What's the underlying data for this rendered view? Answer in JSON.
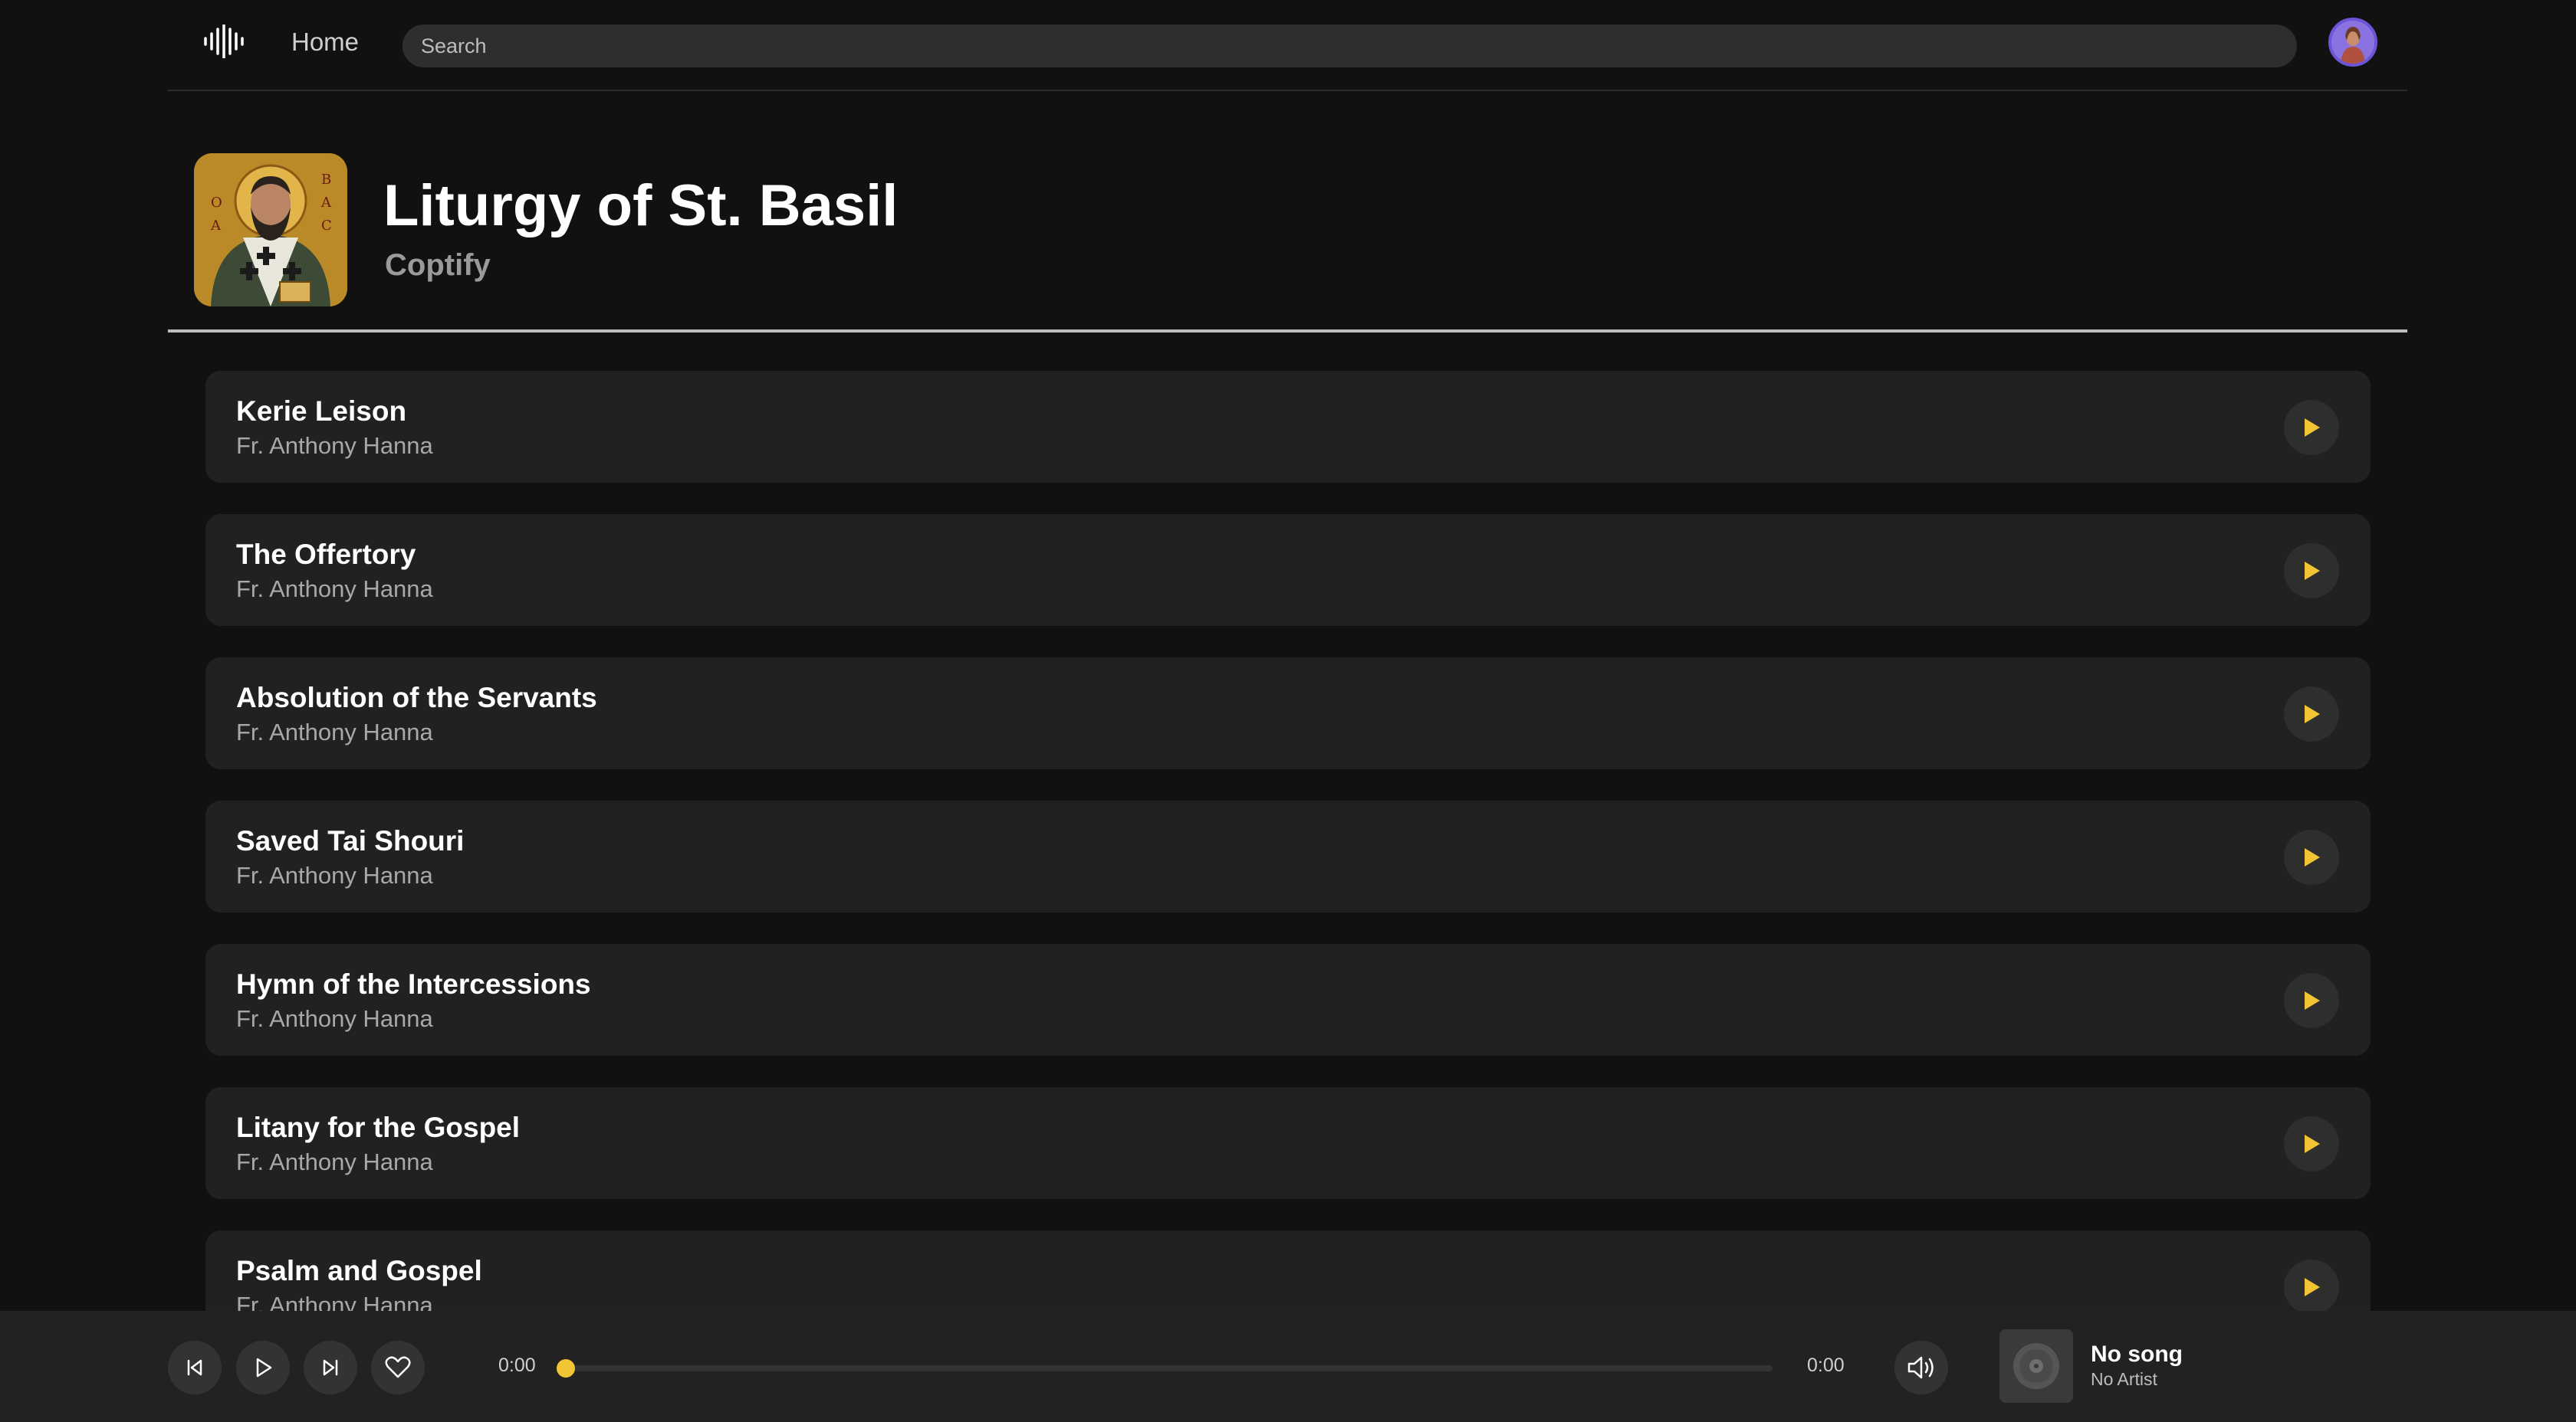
{
  "nav": {
    "home_label": "Home",
    "search_placeholder": "Search",
    "logo_icon": "waveform-icon",
    "avatar_icon": "user-avatar"
  },
  "album": {
    "title": "Liturgy of St. Basil",
    "subtitle": "Coptify",
    "cover_icon": "icon-portrait"
  },
  "tracks": [
    {
      "title": "Kerie Leison",
      "artist": "Fr. Anthony Hanna"
    },
    {
      "title": "The Offertory",
      "artist": "Fr. Anthony Hanna"
    },
    {
      "title": "Absolution of the Servants",
      "artist": "Fr. Anthony Hanna"
    },
    {
      "title": "Saved Tai Shouri",
      "artist": "Fr. Anthony Hanna"
    },
    {
      "title": "Hymn of the Intercessions",
      "artist": "Fr. Anthony Hanna"
    },
    {
      "title": "Litany for the Gospel",
      "artist": "Fr. Anthony Hanna"
    },
    {
      "title": "Psalm and Gospel",
      "artist": "Fr. Anthony Hanna"
    }
  ],
  "player": {
    "current_time": "0:00",
    "duration": "0:00",
    "progress": 0,
    "now_playing_title": "No song",
    "now_playing_artist": "No Artist",
    "icons": [
      "skip-back-icon",
      "play-icon",
      "skip-forward-icon",
      "heart-icon",
      "volume-icon",
      "vinyl-icon"
    ]
  },
  "colors": {
    "background": "#111111",
    "card": "#212121",
    "accent": "#f2c535",
    "player_bar": "#222222"
  }
}
